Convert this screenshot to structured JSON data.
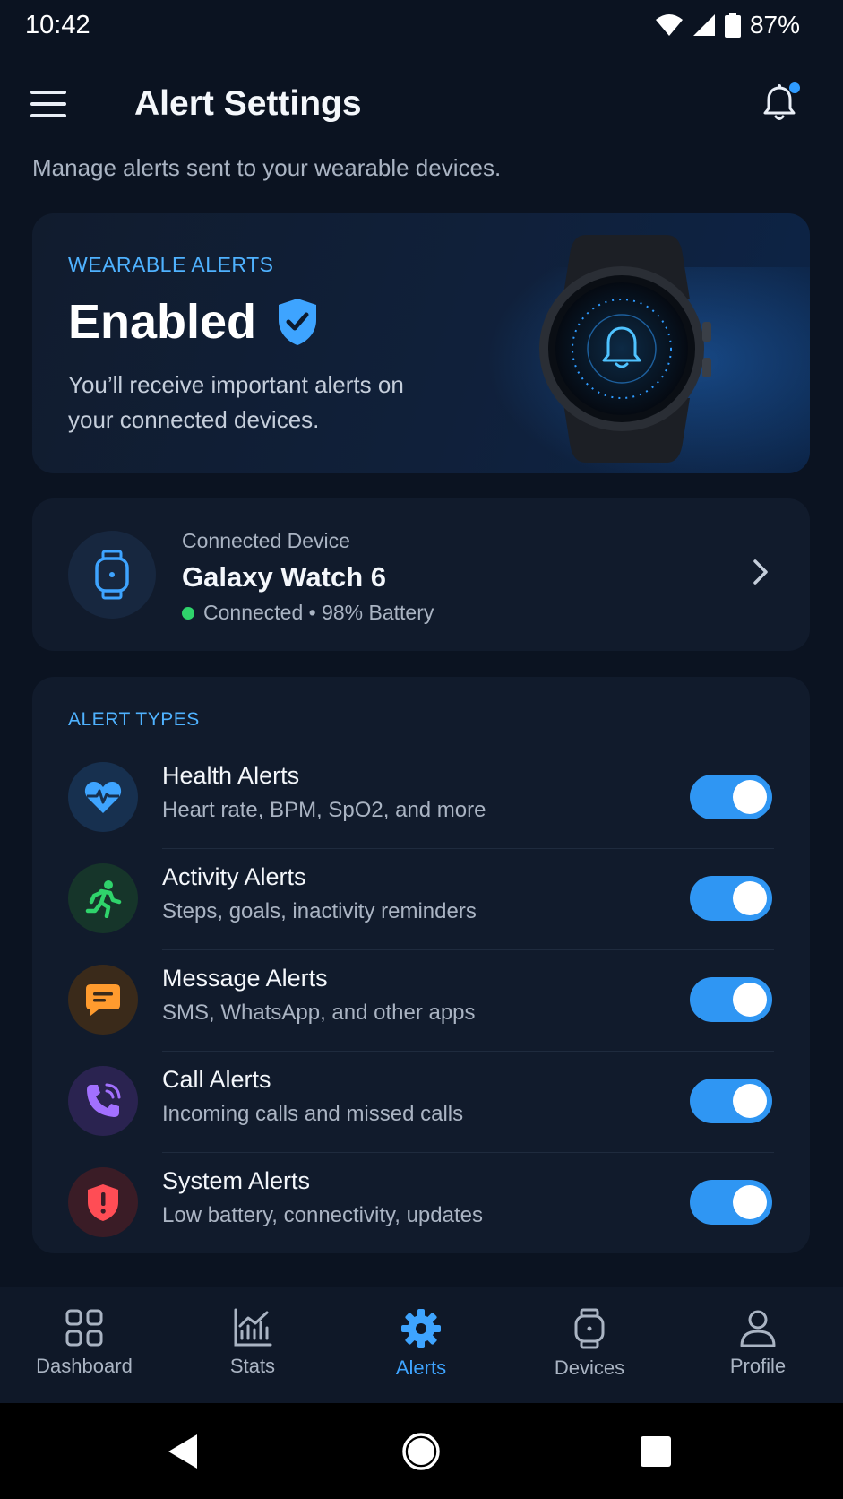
{
  "status_bar": {
    "time": "10:42",
    "battery": "87%"
  },
  "header": {
    "title": "Alert Settings",
    "subtitle": "Manage alerts sent to your wearable devices."
  },
  "hero": {
    "label": "WEARABLE ALERTS",
    "status": "Enabled",
    "description": "You’ll receive important alerts on your connected devices."
  },
  "device": {
    "caption": "Connected Device",
    "name": "Galaxy Watch 6",
    "status": "Connected • 98% Battery"
  },
  "alert_types": {
    "label": "ALERT TYPES",
    "items": [
      {
        "title": "Health Alerts",
        "desc": "Heart rate, BPM, SpO2, and more",
        "icon": "heart-icon",
        "icon_color": "#3ea4ff",
        "bg": "#17304f",
        "enabled": true
      },
      {
        "title": "Activity Alerts",
        "desc": "Steps, goals, inactivity reminders",
        "icon": "running-icon",
        "icon_color": "#2fd36b",
        "bg": "#16352a",
        "enabled": true
      },
      {
        "title": "Message Alerts",
        "desc": "SMS, WhatsApp, and other apps",
        "icon": "message-icon",
        "icon_color": "#ff9b2e",
        "bg": "#3a2a1a",
        "enabled": true
      },
      {
        "title": "Call Alerts",
        "desc": "Incoming calls and missed calls",
        "icon": "phone-icon",
        "icon_color": "#a270ff",
        "bg": "#2a2350",
        "enabled": true
      },
      {
        "title": "System Alerts",
        "desc": "Low battery, connectivity, updates",
        "icon": "shield-alert-icon",
        "icon_color": "#ff4d55",
        "bg": "#3a1c26",
        "enabled": true
      }
    ]
  },
  "bottom_nav": [
    {
      "label": "Dashboard",
      "icon": "grid-icon",
      "active": false
    },
    {
      "label": "Stats",
      "icon": "chart-icon",
      "active": false
    },
    {
      "label": "Alerts",
      "icon": "gear-icon",
      "active": true
    },
    {
      "label": "Devices",
      "icon": "watch-icon",
      "active": false
    },
    {
      "label": "Profile",
      "icon": "person-icon",
      "active": false
    }
  ],
  "colors": {
    "accent": "#2f96f3",
    "background": "#0b1321",
    "card": "#111b2c"
  }
}
